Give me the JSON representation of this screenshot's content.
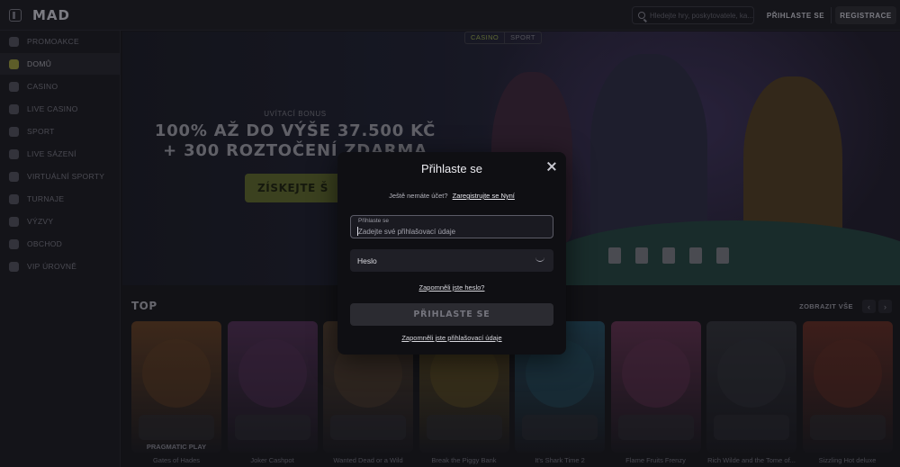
{
  "header": {
    "logo": "MAD",
    "search_placeholder": "Hledejte hry, poskytovatele, ka...",
    "login_label": "PŘIHLASTE SE",
    "register_label": "REGISTRACE"
  },
  "sidebar": {
    "items": [
      {
        "label": "PROMOAKCE",
        "icon": "gift-icon"
      },
      {
        "label": "DOMŮ",
        "icon": "home-icon",
        "active": true
      },
      {
        "label": "CASINO",
        "icon": "casino-icon"
      },
      {
        "label": "LIVE CASINO",
        "icon": "live-casino-icon"
      },
      {
        "label": "SPORT",
        "icon": "ball-icon"
      },
      {
        "label": "LIVE SÁZENÍ",
        "icon": "live-bet-icon"
      },
      {
        "label": "VIRTUÁLNÍ SPORTY",
        "icon": "controller-icon"
      },
      {
        "label": "TURNAJE",
        "icon": "trophy-icon"
      },
      {
        "label": "VÝZVY",
        "icon": "challenge-icon"
      },
      {
        "label": "OBCHOD",
        "icon": "shop-icon"
      },
      {
        "label": "VIP ÚROVNĚ",
        "icon": "crown-icon"
      }
    ]
  },
  "hero": {
    "tabs": [
      "CASINO",
      "SPORT"
    ],
    "bonus_label": "UVÍTACÍ BONUS",
    "bonus_line1": "100% AŽ DO VÝŠE 37.500 KČ",
    "bonus_line2": "+ 300 ROZTOČENÍ ZDARMA",
    "cta_label": "ZÍSKEJTE Š"
  },
  "top_games": {
    "title": "TOP",
    "show_all": "ZOBRAZIT VŠE",
    "prev_icon": "‹",
    "next_icon": "›",
    "games": [
      {
        "title": "Gates of Hades",
        "provider": "PRAGMATIC PLAY",
        "color": "#5a3a22"
      },
      {
        "title": "Joker Cashpot",
        "provider": "",
        "color": "#4a2c4e"
      },
      {
        "title": "Wanted Dead or a Wild",
        "provider": "",
        "color": "#4b3a2c"
      },
      {
        "title": "Break the Piggy Bank",
        "provider": "",
        "color": "#5a4a22"
      },
      {
        "title": "It's Shark Time 2",
        "provider": "",
        "color": "#23485a"
      },
      {
        "title": "Flame Fruits Frenzy",
        "provider": "",
        "color": "#5a2e4a"
      },
      {
        "title": "Rich Wilde and the Tome of...",
        "provider": "",
        "color": "#2e2f36"
      },
      {
        "title": "Sizzling Hot deluxe",
        "provider": "",
        "color": "#5a2a22"
      }
    ]
  },
  "modal": {
    "title": "Přihlaste se",
    "no_account": "Ještě nemáte účet?",
    "register_link": "Zaregistrujte se Nyní",
    "login_field_label": "Přihlaste se",
    "login_field_placeholder": "Zadejte své přihlašovací údaje",
    "password_label": "Heslo",
    "forgot_password": "Zapomněli jste heslo?",
    "submit_label": "PŘIHLASTE SE",
    "forgot_credentials": "Zapomněli jste přihlašovací údaje"
  }
}
